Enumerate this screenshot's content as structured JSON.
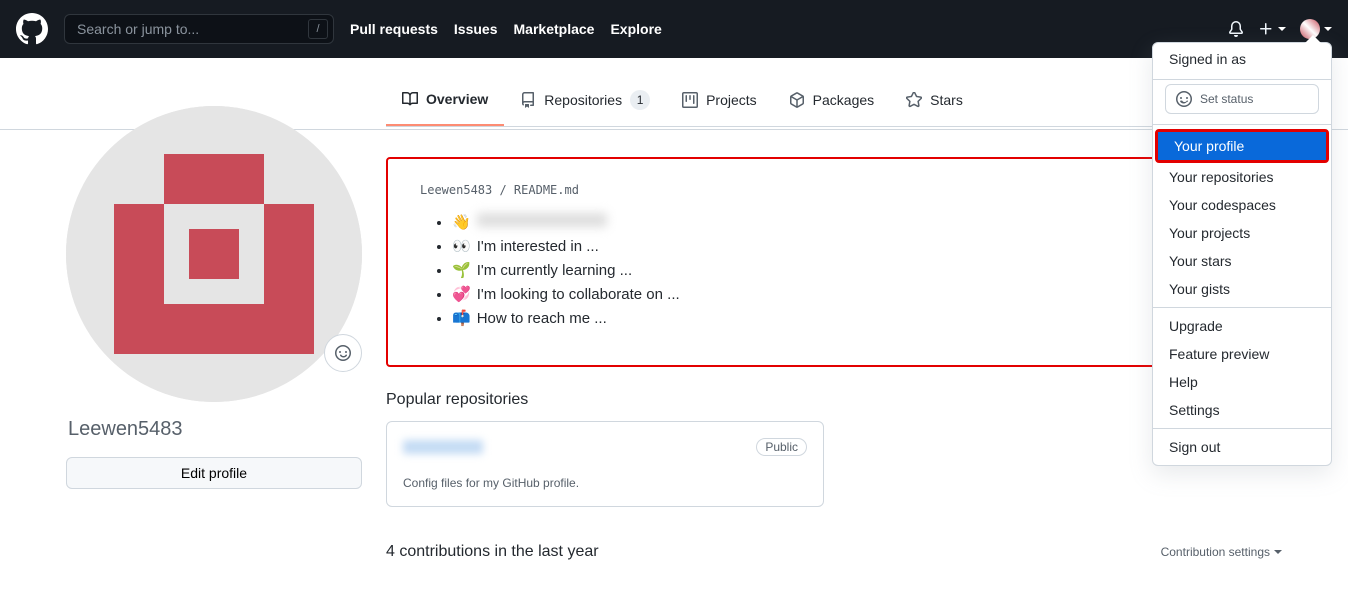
{
  "header": {
    "search_placeholder": "Search or jump to...",
    "nav": {
      "pulls": "Pull requests",
      "issues": "Issues",
      "marketplace": "Marketplace",
      "explore": "Explore"
    }
  },
  "dropdown": {
    "signed_in": "Signed in as",
    "set_status": "Set status",
    "your_profile": "Your profile",
    "your_repositories": "Your repositories",
    "your_codespaces": "Your codespaces",
    "your_projects": "Your projects",
    "your_stars": "Your stars",
    "your_gists": "Your gists",
    "upgrade": "Upgrade",
    "feature_preview": "Feature preview",
    "help": "Help",
    "settings": "Settings",
    "sign_out": "Sign out"
  },
  "profile": {
    "username": "Leewen5483",
    "edit_profile": "Edit profile"
  },
  "tabs": {
    "overview": "Overview",
    "repositories": "Repositories",
    "repo_count": "1",
    "projects": "Projects",
    "packages": "Packages",
    "stars": "Stars"
  },
  "readme": {
    "path": "Leewen5483 / README.md",
    "items": {
      "interested": "I'm interested in ...",
      "learning": "I'm currently learning ...",
      "collab": "I'm looking to collaborate on ...",
      "reach": "How to reach me ..."
    }
  },
  "popular": {
    "title": "Popular repositories",
    "public_label": "Public",
    "desc": "Config files for my GitHub profile."
  },
  "contributions": {
    "text": "4 contributions in the last year",
    "settings": "Contribution settings"
  }
}
